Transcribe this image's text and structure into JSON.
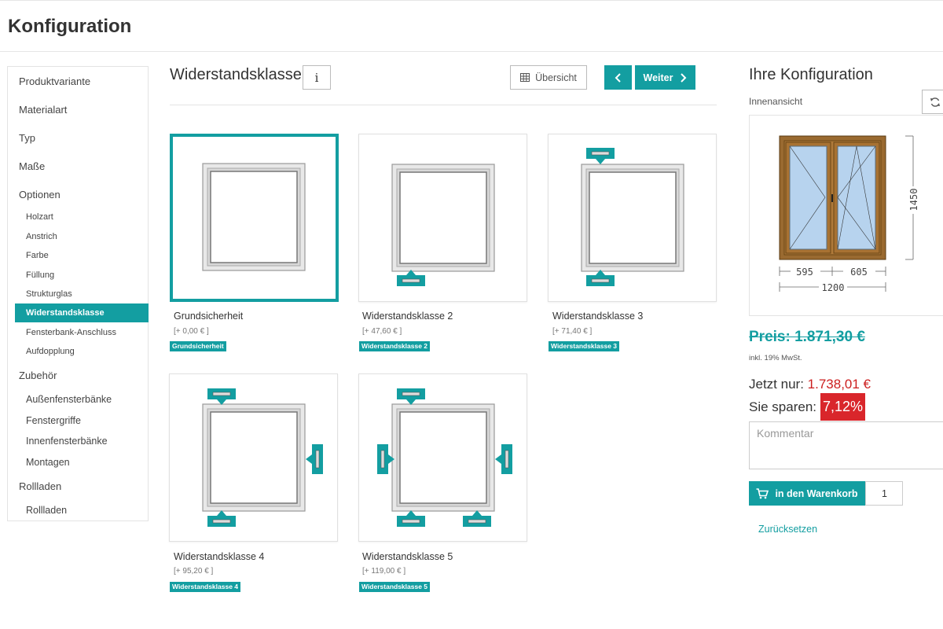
{
  "page": {
    "title": "Konfiguration"
  },
  "sidebar": {
    "items": [
      {
        "label": "Produktvariante"
      },
      {
        "label": "Materialart"
      },
      {
        "label": "Typ"
      },
      {
        "label": "Maße"
      },
      {
        "label": "Optionen"
      },
      {
        "label": "Holzart"
      },
      {
        "label": "Anstrich"
      },
      {
        "label": "Farbe"
      },
      {
        "label": "Füllung"
      },
      {
        "label": "Strukturglas"
      },
      {
        "label": "Widerstandsklasse",
        "active": true
      },
      {
        "label": "Fensterbank-Anschluss"
      },
      {
        "label": "Aufdopplung"
      },
      {
        "label": "Zubehör"
      },
      {
        "label": "Außenfensterbänke"
      },
      {
        "label": "Fenstergriffe"
      },
      {
        "label": "Innenfensterbänke"
      },
      {
        "label": "Montagen"
      },
      {
        "label": "Rollladen"
      },
      {
        "label": "Rollladen"
      }
    ]
  },
  "main": {
    "section_title": "Widerstandsklasse",
    "info_label": "i",
    "overview_label": "Übersicht",
    "next_label": "Weiter",
    "options": [
      {
        "name": "Grundsicherheit",
        "price": "[+ 0,00 € ]",
        "tag": "Grundsicherheit",
        "selected": true
      },
      {
        "name": "Widerstandsklasse 2",
        "price": "[+ 47,60 € ]",
        "tag": "Widerstandsklasse 2"
      },
      {
        "name": "Widerstandsklasse 3",
        "price": "[+ 71,40 € ]",
        "tag": "Widerstandsklasse 3"
      },
      {
        "name": "Widerstandsklasse 4",
        "price": "[+ 95,20 € ]",
        "tag": "Widerstandsklasse 4"
      },
      {
        "name": "Widerstandsklasse 5",
        "price": "[+ 119,00 € ]",
        "tag": "Widerstandsklasse 5"
      }
    ]
  },
  "summary": {
    "title": "Ihre Konfiguration",
    "view_label": "Innenansicht",
    "dimensions": {
      "total_width": "1200",
      "left_width": "595",
      "right_width": "605",
      "height": "1450"
    },
    "old_price": "Preis: 1.871,30 €",
    "vat_note": "inkl. 19% MwSt.",
    "now_label": "Jetzt nur:",
    "now_price": "1.738,01 €",
    "save_label": "Sie sparen:",
    "save_percent": "7,12%",
    "comment_placeholder": "Kommentar",
    "cart_label": "in den Warenkorb",
    "quantity": "1",
    "reset_label": "Zurücksetzen"
  },
  "colors": {
    "accent": "#139ea1",
    "sale_red": "#cc1f1f",
    "badge_red": "#d9262b",
    "frame_wood": "#9a6a30",
    "glass": "#b7d3ee"
  }
}
